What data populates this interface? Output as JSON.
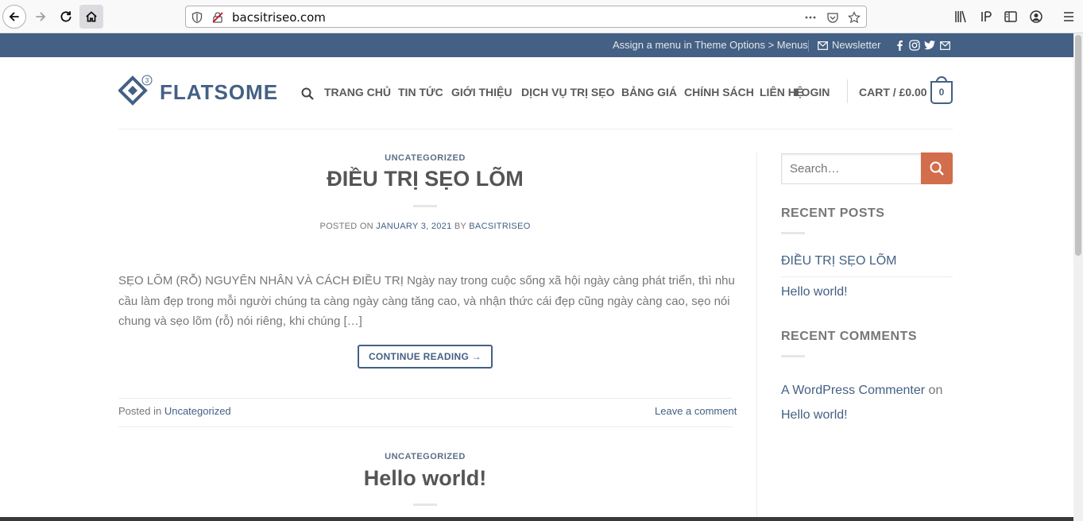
{
  "browser": {
    "url": "bacsitriseo.com"
  },
  "topbar": {
    "menu_hint": "Assign a menu in Theme Options > Menus",
    "newsletter": "Newsletter"
  },
  "header": {
    "logo_text": "FLATSOME",
    "logo_badge": "3",
    "nav": [
      "TRANG CHỦ",
      "TIN TỨC",
      "GIỚI THIỆU",
      "DỊCH VỤ TRỊ SẸO",
      "BẢNG GIÁ",
      "CHÍNH SÁCH",
      "LIÊN HỆ",
      "LOGIN"
    ],
    "cart_label": "CART / £0.00",
    "cart_count": "0"
  },
  "posts": [
    {
      "category": "UNCATEGORIZED",
      "title": "ĐIỀU TRỊ SẸO LÕM",
      "posted_on_label": "POSTED ON",
      "date": "JANUARY 3, 2021",
      "by_label": "BY",
      "author": "BACSITRISEO",
      "excerpt": "SẸO LÕM (RỖ) NGUYÊN NHÂN VÀ CÁCH ĐIỀU TRỊ Ngày nay trong cuộc sống xã hội ngày càng phát triển, thì nhu cầu làm đẹp trong mỗi người chúng ta càng ngày càng tăng cao, và nhận thức cái đẹp cũng ngày càng cao, sẹo nói chung và sẹo lõm (rỗ) nói riêng, khi chúng […]",
      "continue_label": "CONTINUE READING →",
      "posted_in_label": "Posted in",
      "posted_in_category": "Uncategorized",
      "comment_link": "Leave a comment"
    },
    {
      "category": "UNCATEGORIZED",
      "title": "Hello world!"
    }
  ],
  "sidebar": {
    "search_placeholder": "Search…",
    "recent_posts_title": "RECENT POSTS",
    "recent_posts": [
      "ĐIỀU TRỊ SẸO LÕM",
      "Hello world!"
    ],
    "recent_comments_title": "RECENT COMMENTS",
    "comment_author": "A WordPress Commenter",
    "comment_on": "on",
    "comment_post": "Hello world!"
  },
  "colors": {
    "primary": "#446084",
    "secondary": "#d26e4b"
  }
}
